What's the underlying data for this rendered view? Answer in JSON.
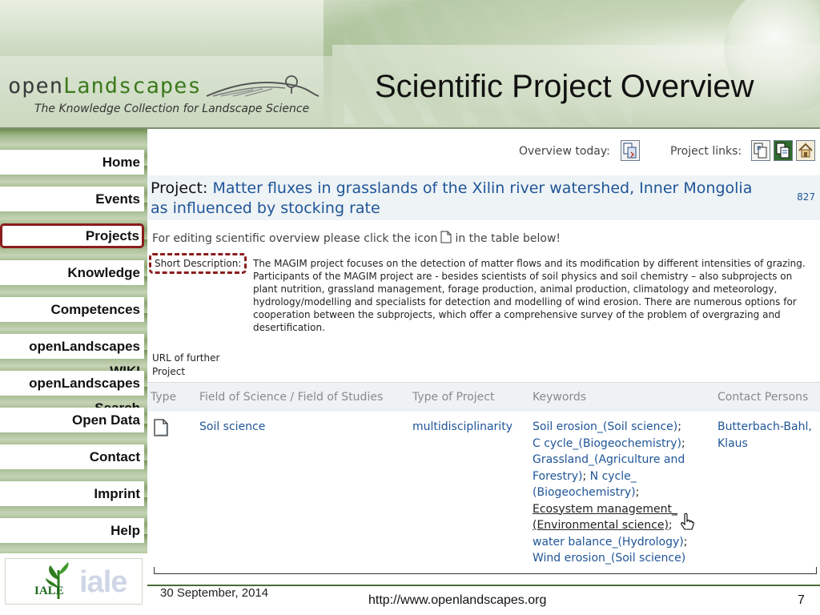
{
  "slide": {
    "title": "Scientific Project Overview",
    "brand_open": "open",
    "brand_name": "Landscapes",
    "tagline": "The Knowledge Collection for Landscape Science",
    "footer_date": "30 September, 2014",
    "footer_url": "http://www.openlandscapes.org",
    "page_number": "7",
    "partner_logo_text": "iale",
    "partner_logo_sub": "IALE"
  },
  "nav": {
    "items": [
      {
        "label": "Home",
        "active": false
      },
      {
        "label": "Events",
        "active": false
      },
      {
        "label": "Projects",
        "active": true
      },
      {
        "label": "Knowledge",
        "active": false
      },
      {
        "label": "Competences",
        "active": false
      },
      {
        "label": "openLandscapes WIKI",
        "active": false
      },
      {
        "label": "openLandscapes Search",
        "active": false
      },
      {
        "label": "Open Data",
        "active": false
      },
      {
        "label": "Contact",
        "active": false
      },
      {
        "label": "Imprint",
        "active": false
      },
      {
        "label": "Help",
        "active": false
      }
    ]
  },
  "toolbar": {
    "overview_today_label": "Overview today:",
    "project_links_label": "Project links:",
    "icons": [
      "overview-icon",
      "project-link-icon-1",
      "project-link-icon-2",
      "home-icon"
    ]
  },
  "project": {
    "prefix": "Project:",
    "title": "Matter fluxes in grasslands of the Xilin river watershed, Inner Mongolia as influenced by stocking rate",
    "id": "827",
    "editing_note_before": "For editing scientific overview please click the icon",
    "editing_note_after": "in the table below!",
    "short_description_label": "Short Description:",
    "short_description_1": "The MAGIM project focuses on the detection of matter flows and its modification by different intensities of grazing.",
    "short_description_2": "Participants of the MAGIM project are - besides scientists of soil physics and soil chemistry – also subprojects on plant nutrition, grassland management, forage production, animal production, climatology and meteorology, hydrology/modelling and specialists for detection and modelling of wind erosion. There are numerous options for cooperation between the subprojects, which offer a comprehensive survey of the problem of overgrazing and desertification.",
    "url_label": "URL of further Project"
  },
  "table": {
    "headers": [
      "Type",
      "Field of Science / Field of Studies",
      "Type of Project",
      "Keywords",
      "Contact Persons"
    ],
    "row": {
      "field": "Soil science",
      "project_type": "multidisciplinarity",
      "keywords": [
        "Soil erosion_(Soil science)",
        "C cycle_(Biogeochemistry)",
        "Grassland_(Agriculture and Forestry)",
        "N cycle_ (Biogeochemistry)",
        "Ecosystem management_ (Environmental science)",
        "water balance_(Hydrology)",
        "Wind erosion_(Soil science)"
      ],
      "contact": "Butterbach-Bahl, Klaus"
    }
  },
  "colors": {
    "accent_red": "#8b1c1c",
    "link_blue": "#1f5597",
    "brand_green": "#3d7a1d"
  }
}
